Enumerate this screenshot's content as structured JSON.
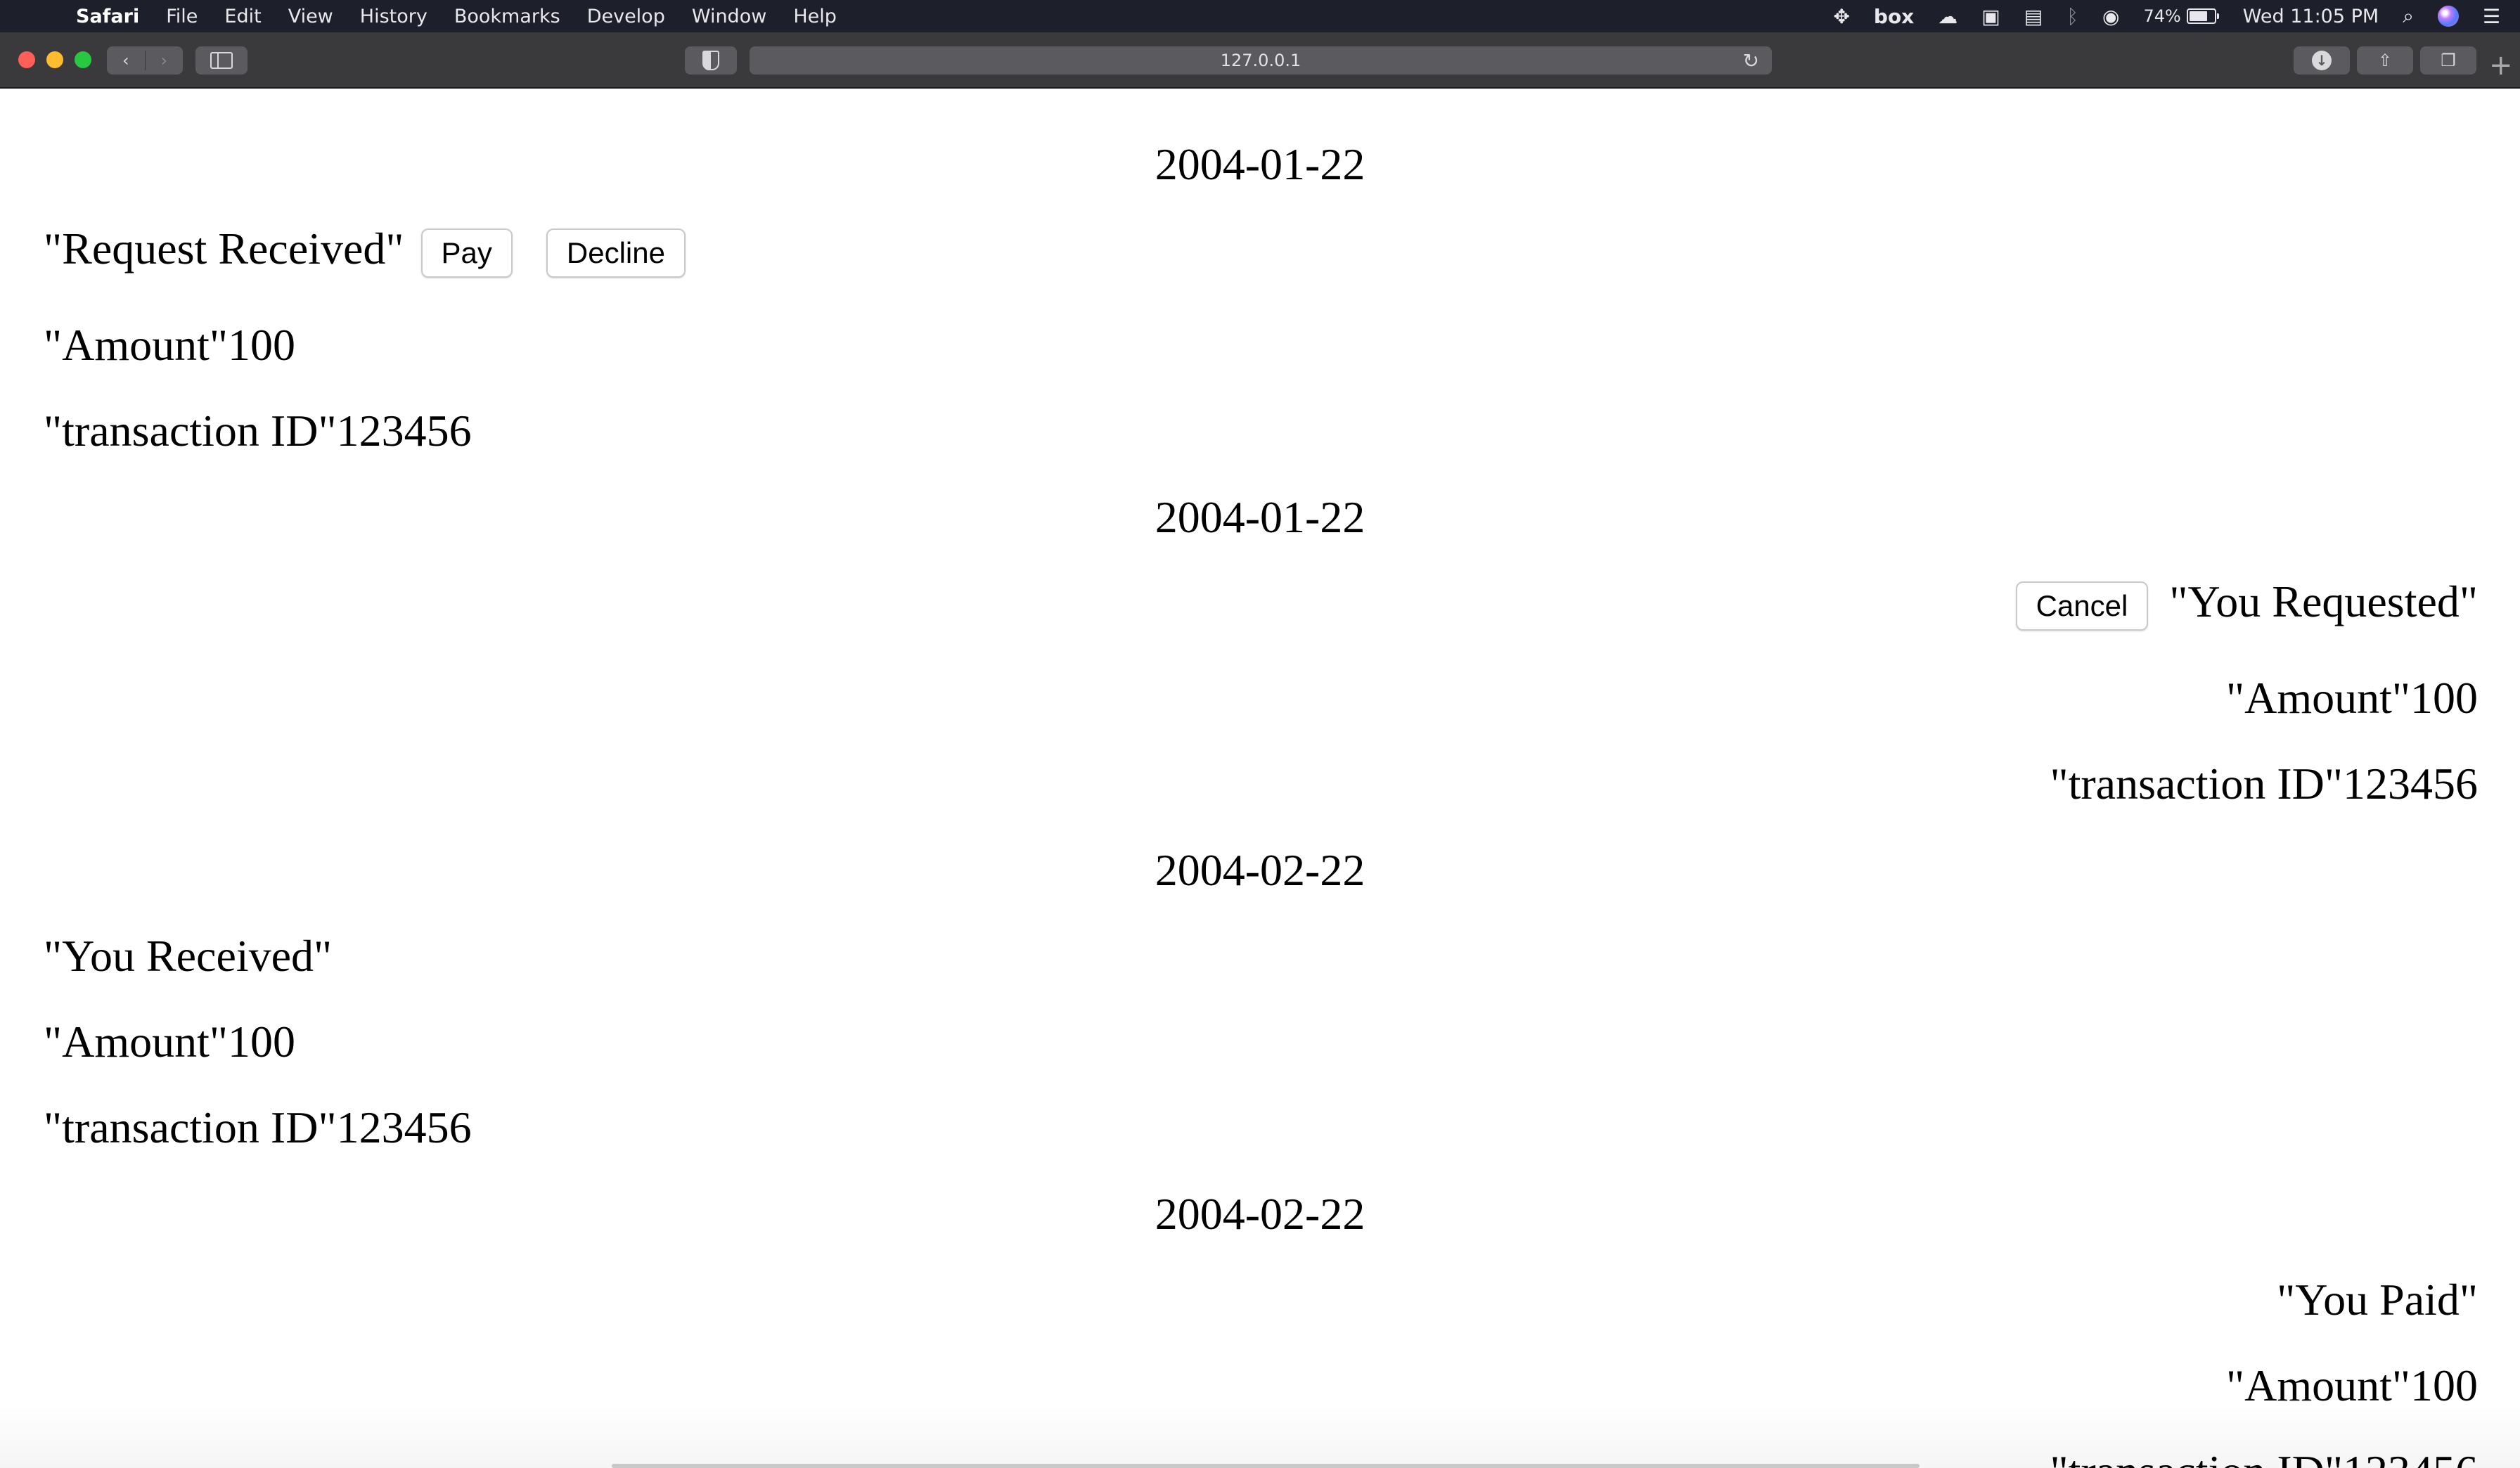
{
  "menubar": {
    "app_name": "Safari",
    "items": [
      "File",
      "Edit",
      "View",
      "History",
      "Bookmarks",
      "Develop",
      "Window",
      "Help"
    ],
    "status": {
      "box_label": "box",
      "battery_percent": "74%",
      "battery_level": 0.74,
      "clock": "Wed 11:05 PM"
    }
  },
  "browser": {
    "url": "127.0.0.1"
  },
  "transactions": [
    {
      "date": "2004-01-22",
      "status": "\"Request Received\"",
      "actions": [
        "Pay",
        "Decline"
      ],
      "amount": "\"Amount\"100",
      "transaction_id": "\"transaction ID\"123456"
    },
    {
      "date": "2004-01-22",
      "status": "\"You Requested\"",
      "actions": [
        "Cancel"
      ],
      "amount": "\"Amount\"100",
      "transaction_id": "\"transaction ID\"123456"
    },
    {
      "date": "2004-02-22",
      "status": "\"You Received\"",
      "actions": [],
      "amount": "\"Amount\"100",
      "transaction_id": "\"transaction ID\"123456"
    },
    {
      "date": "2004-02-22",
      "status": "\"You Paid\"",
      "actions": [],
      "amount": "\"Amount\"100",
      "transaction_id": "\"transaction ID\"123456"
    }
  ]
}
